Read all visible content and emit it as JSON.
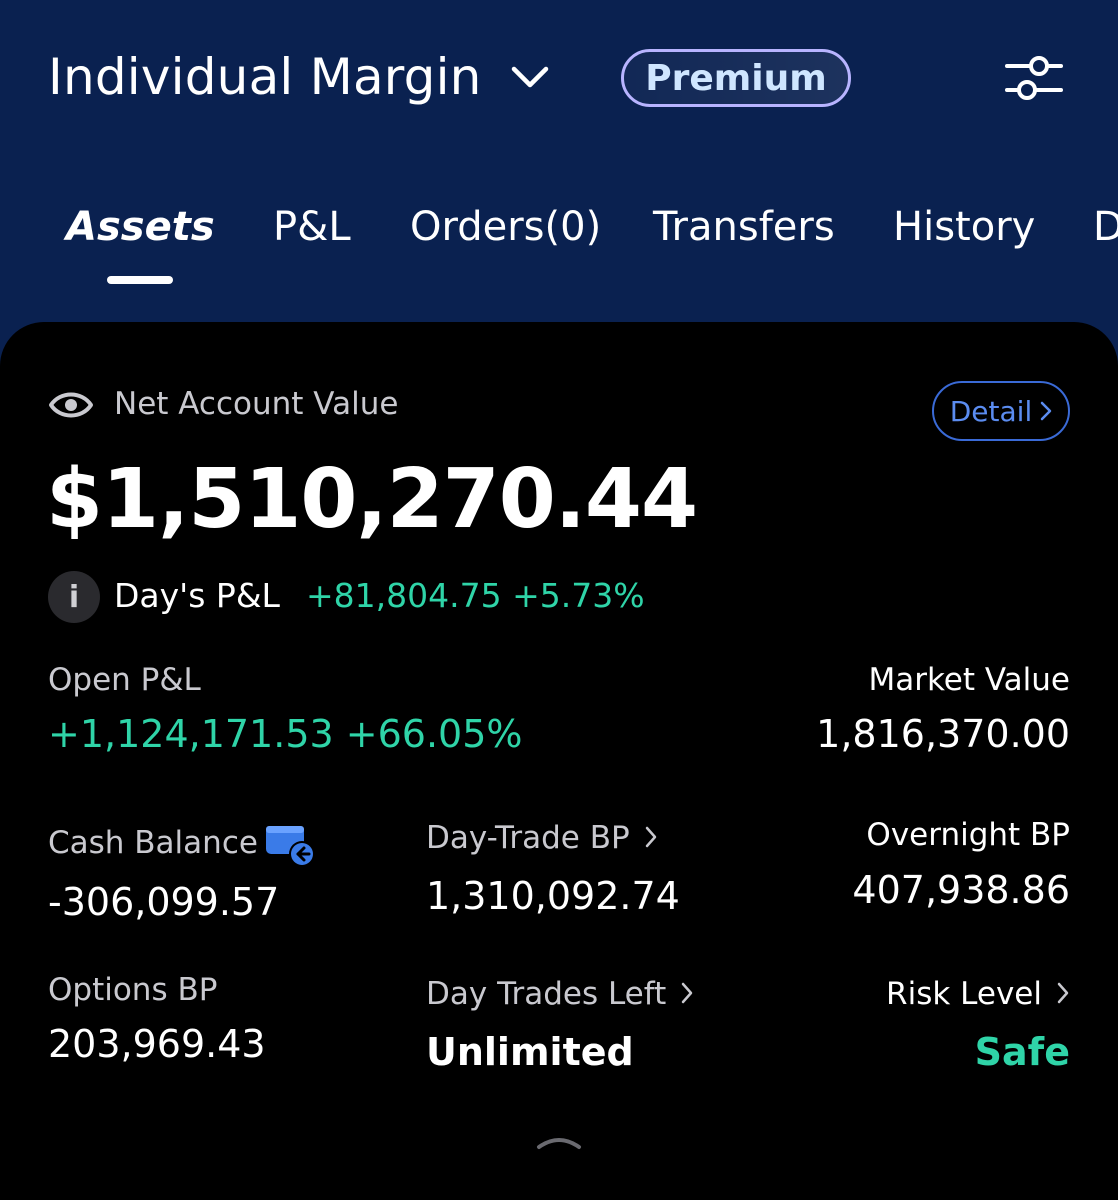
{
  "header": {
    "account_name": "Individual Margin",
    "badge": "Premium",
    "icons": {
      "dropdown": "chevron-down-icon",
      "settings": "sliders-icon"
    }
  },
  "tabs": [
    {
      "label": "Assets",
      "active": true
    },
    {
      "label": "P&L",
      "active": false
    },
    {
      "label": "Orders(0)",
      "active": false
    },
    {
      "label": "Transfers",
      "active": false
    },
    {
      "label": "History",
      "active": false
    },
    {
      "label": "D",
      "active": false
    }
  ],
  "summary": {
    "net_account_value_label": "Net Account Value",
    "detail_button": "Detail",
    "net_account_value": "$1,510,270.44",
    "days_pl_label": "Day's P&L",
    "days_pl_value": "+81,804.75 +5.73%"
  },
  "metrics": {
    "open_pl_label": "Open P&L",
    "open_pl_value": "+1,124,171.53 +66.05%",
    "market_value_label": "Market Value",
    "market_value": "1,816,370.00",
    "cash_balance_label": "Cash Balance",
    "cash_balance": "-306,099.57",
    "day_trade_bp_label": "Day-Trade BP",
    "day_trade_bp": "1,310,092.74",
    "overnight_bp_label": "Overnight BP",
    "overnight_bp": "407,938.86",
    "options_bp_label": "Options BP",
    "options_bp": "203,969.43",
    "day_trades_left_label": "Day Trades Left",
    "day_trades_left": "Unlimited",
    "risk_level_label": "Risk Level",
    "risk_level": "Safe"
  },
  "colors": {
    "header_bg": "#0a2150",
    "positive": "#2fd4a8",
    "accent_blue": "#3a6ad6"
  }
}
